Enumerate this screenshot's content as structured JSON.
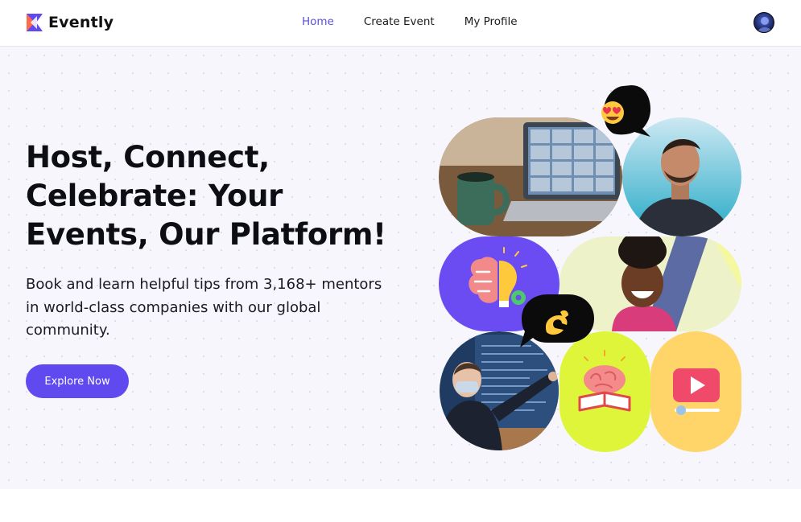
{
  "app": {
    "brand": "Evently"
  },
  "nav": {
    "items": [
      {
        "label": "Home",
        "active": true
      },
      {
        "label": "Create Event",
        "active": false
      },
      {
        "label": "My Profile",
        "active": false
      }
    ]
  },
  "hero": {
    "title_lines": [
      "Host, Connect,",
      "Celebrate: Your",
      "Events, Our Platform!"
    ],
    "subtitle_lines": [
      "Book and learn helpful tips from 3,168+ mentors",
      "in world-class companies with our global",
      "community."
    ],
    "cta_label": "Explore Now"
  },
  "colors": {
    "accent": "#6149f0",
    "nav_active": "#5a4fd8",
    "hero_bg": "#f6f6fc",
    "tile_purple": "#6a4cf2",
    "tile_lime": "#dff53a",
    "tile_orange": "#ffd56a"
  },
  "collage": {
    "icons": [
      "video-call-photo",
      "smiling-man-photo",
      "brain-idea-icon",
      "laughing-woman-photo",
      "presenter-photo",
      "brain-book-icon",
      "play-video-icon",
      "heart-eyes-emoji-bubble",
      "pinching-hand-emoji-bubble"
    ]
  }
}
